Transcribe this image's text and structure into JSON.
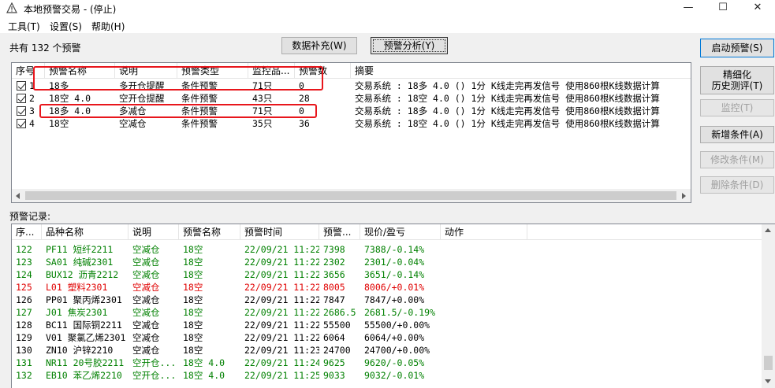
{
  "window": {
    "title": "本地预警交易  - (停止)"
  },
  "menu": [
    "工具(T)",
    "设置(S)",
    "帮助(H)"
  ],
  "summary": "共有 132 个预警",
  "top_buttons": {
    "data_fill": "数据补充(W)",
    "analysis": "预警分析(Y)"
  },
  "side_buttons": {
    "start": "启动预警(S)",
    "refine_line1": "精细化",
    "refine_line2": "历史测评(T)",
    "monitor": "监控(T)",
    "add_cond": "新增条件(A)",
    "edit_cond": "修改条件(M)",
    "delete_cond": "删除条件(D)"
  },
  "alerts": {
    "headers": [
      "序号",
      "预警名称",
      "说明",
      "预警类型",
      "监控品...",
      "预警数",
      "摘要"
    ],
    "rows": [
      {
        "idx": "1",
        "name": "18多",
        "desc": "多开仓提醒",
        "type": "条件预警",
        "count": "71只",
        "num": "0",
        "summary": "交易系统 : 18多  4.0 () 1分 K线走完再发信号 使用860根K线数据计算"
      },
      {
        "idx": "2",
        "name": "18空  4.0",
        "desc": "空开仓提醒",
        "type": "条件预警",
        "count": "43只",
        "num": "28",
        "summary": "交易系统 : 18空  4.0 () 1分 K线走完再发信号 使用860根K线数据计算"
      },
      {
        "idx": "3",
        "name": "18多  4.0",
        "desc": "多减仓",
        "type": "条件预警",
        "count": "71只",
        "num": "0",
        "summary": "交易系统 : 18多  4.0 () 1分 K线走完再发信号 使用860根K线数据计算"
      },
      {
        "idx": "4",
        "name": "18空",
        "desc": "空减仓",
        "type": "条件预警",
        "count": "35只",
        "num": "36",
        "summary": "交易系统 : 18空  4.0 () 1分 K线走完再发信号 使用860根K线数据计算"
      }
    ]
  },
  "records_label": "预警记录:",
  "records": {
    "headers": [
      "序...",
      "品种名称",
      "说明",
      "预警名称",
      "预警时间",
      "预警...",
      "现价/盈亏",
      "动作"
    ],
    "rows": [
      {
        "idx": "122",
        "name": "PF11 短纤2211",
        "desc": "空减仓",
        "alert": "18空",
        "time": "22/09/21 11:22",
        "price": "7398",
        "pnl": "7388/-0.14%",
        "color": "green"
      },
      {
        "idx": "123",
        "name": "SA01 纯碱2301",
        "desc": "空减仓",
        "alert": "18空",
        "time": "22/09/21 11:22",
        "price": "2302",
        "pnl": "2301/-0.04%",
        "color": "green"
      },
      {
        "idx": "124",
        "name": "BUX12 沥青2212",
        "desc": "空减仓",
        "alert": "18空",
        "time": "22/09/21 11:22",
        "price": "3656",
        "pnl": "3651/-0.14%",
        "color": "green"
      },
      {
        "idx": "125",
        "name": "L01 塑料2301",
        "desc": "空减仓",
        "alert": "18空",
        "time": "22/09/21 11:22",
        "price": "8005",
        "pnl": "8006/+0.01%",
        "color": "red"
      },
      {
        "idx": "126",
        "name": "PP01 聚丙烯2301",
        "desc": "空减仓",
        "alert": "18空",
        "time": "22/09/21 11:22",
        "price": "7847",
        "pnl": "7847/+0.00%",
        "color": "black"
      },
      {
        "idx": "127",
        "name": "J01 焦炭2301",
        "desc": "空减仓",
        "alert": "18空",
        "time": "22/09/21 11:22",
        "price": "2686.5",
        "pnl": "2681.5/-0.19%",
        "color": "green"
      },
      {
        "idx": "128",
        "name": "BC11 国际铜2211",
        "desc": "空减仓",
        "alert": "18空",
        "time": "22/09/21 11:22",
        "price": "55500",
        "pnl": "55500/+0.00%",
        "color": "black"
      },
      {
        "idx": "129",
        "name": "V01 聚氯乙烯2301",
        "desc": "空减仓",
        "alert": "18空",
        "time": "22/09/21 11:22",
        "price": "6064",
        "pnl": "6064/+0.00%",
        "color": "black"
      },
      {
        "idx": "130",
        "name": "ZN10 沪锌2210",
        "desc": "空减仓",
        "alert": "18空",
        "time": "22/09/21 11:23",
        "price": "24700",
        "pnl": "24700/+0.00%",
        "color": "black"
      },
      {
        "idx": "131",
        "name": "NR11 20号胶2211",
        "desc": "空开仓...",
        "alert": "18空  4.0",
        "time": "22/09/21 11:24",
        "price": "9625",
        "pnl": "9620/-0.05%",
        "color": "green"
      },
      {
        "idx": "132",
        "name": "EB10 苯乙烯2210",
        "desc": "空开仓...",
        "alert": "18空  4.0",
        "time": "22/09/21 11:25",
        "price": "9033",
        "pnl": "9032/-0.01%",
        "color": "green"
      }
    ]
  }
}
